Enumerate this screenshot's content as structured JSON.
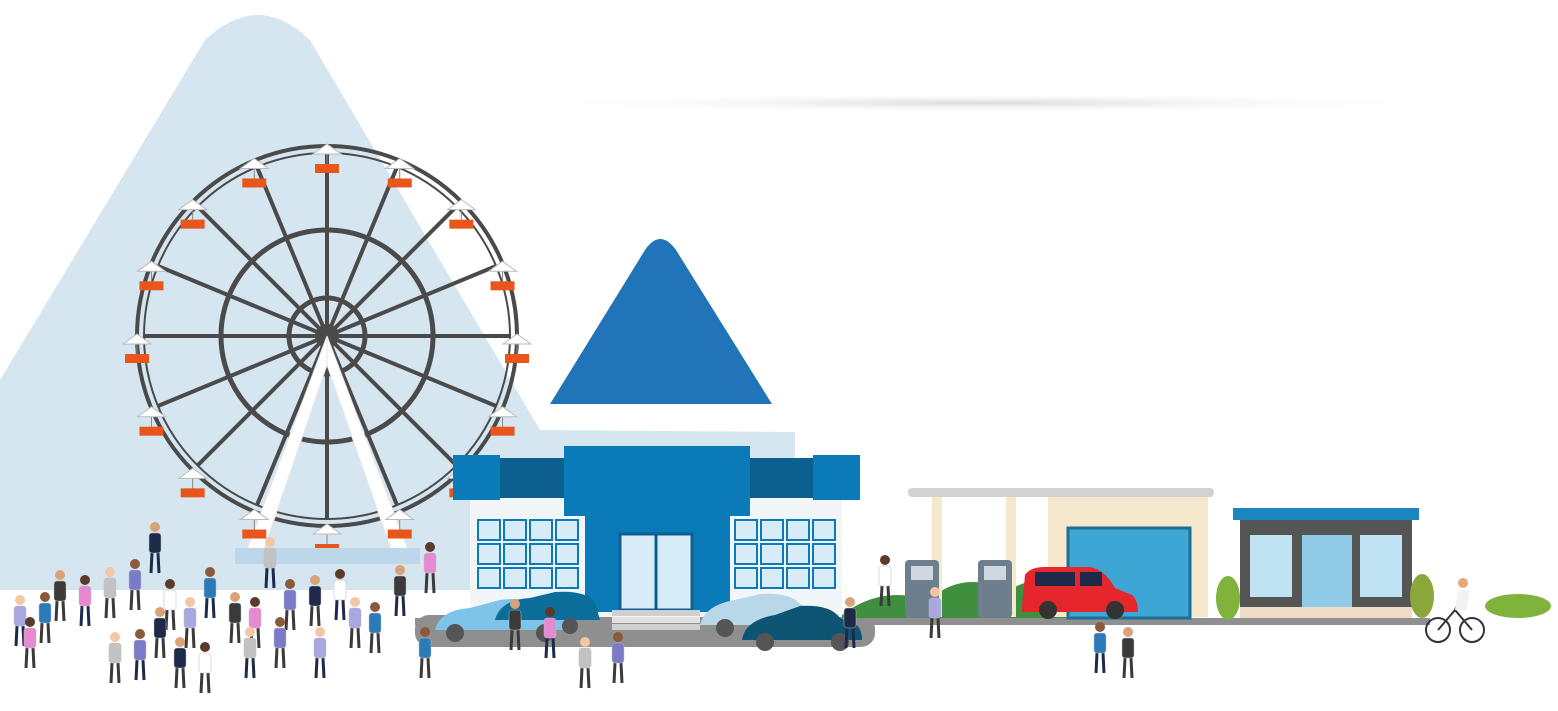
{
  "illustration": {
    "colors": {
      "sky_mountain": "#d6e6f1",
      "pyramid": "#2274b8",
      "building_blue": "#0a7ab9",
      "building_dark": "#0d5f8f",
      "wheel": "#4a4a4a",
      "gondola": "#e8561b",
      "road": "#8f8f8f",
      "station_roof": "#cfcfcf",
      "station_wall": "#f6e8cc",
      "red_car": "#e5262d",
      "shop_frame": "#555555",
      "shop_roof": "#1c86c0",
      "bush": "#7fb33c"
    },
    "scene_parts": [
      "ferris-wheel",
      "pyramid-roof",
      "glass-building",
      "fuel-station",
      "red-van",
      "boutique-shop",
      "crowd",
      "cyclist"
    ]
  }
}
